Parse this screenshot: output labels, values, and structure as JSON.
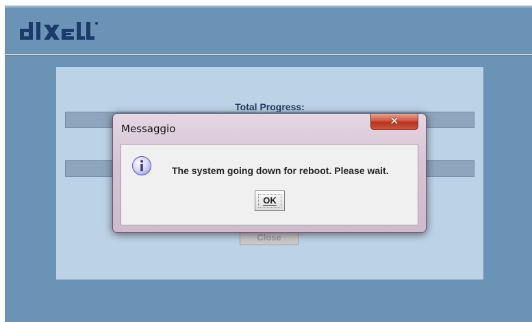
{
  "app": {
    "logo_text": "dIXeLL",
    "total_progress_label": "Total Progress:",
    "close_label": "Close"
  },
  "progress": {
    "total": 0.0,
    "second": 0.0
  },
  "dialog": {
    "title": "Messaggio",
    "message": "The system going down for reboot. Please wait.",
    "ok_label": "OK",
    "close_icon": "close-icon",
    "info_icon": "info-icon"
  },
  "colors": {
    "background": "#6a93b6",
    "panel": "#bcd2e6",
    "logo": "#1e3a6d",
    "close_button_red": "#c83d22"
  }
}
